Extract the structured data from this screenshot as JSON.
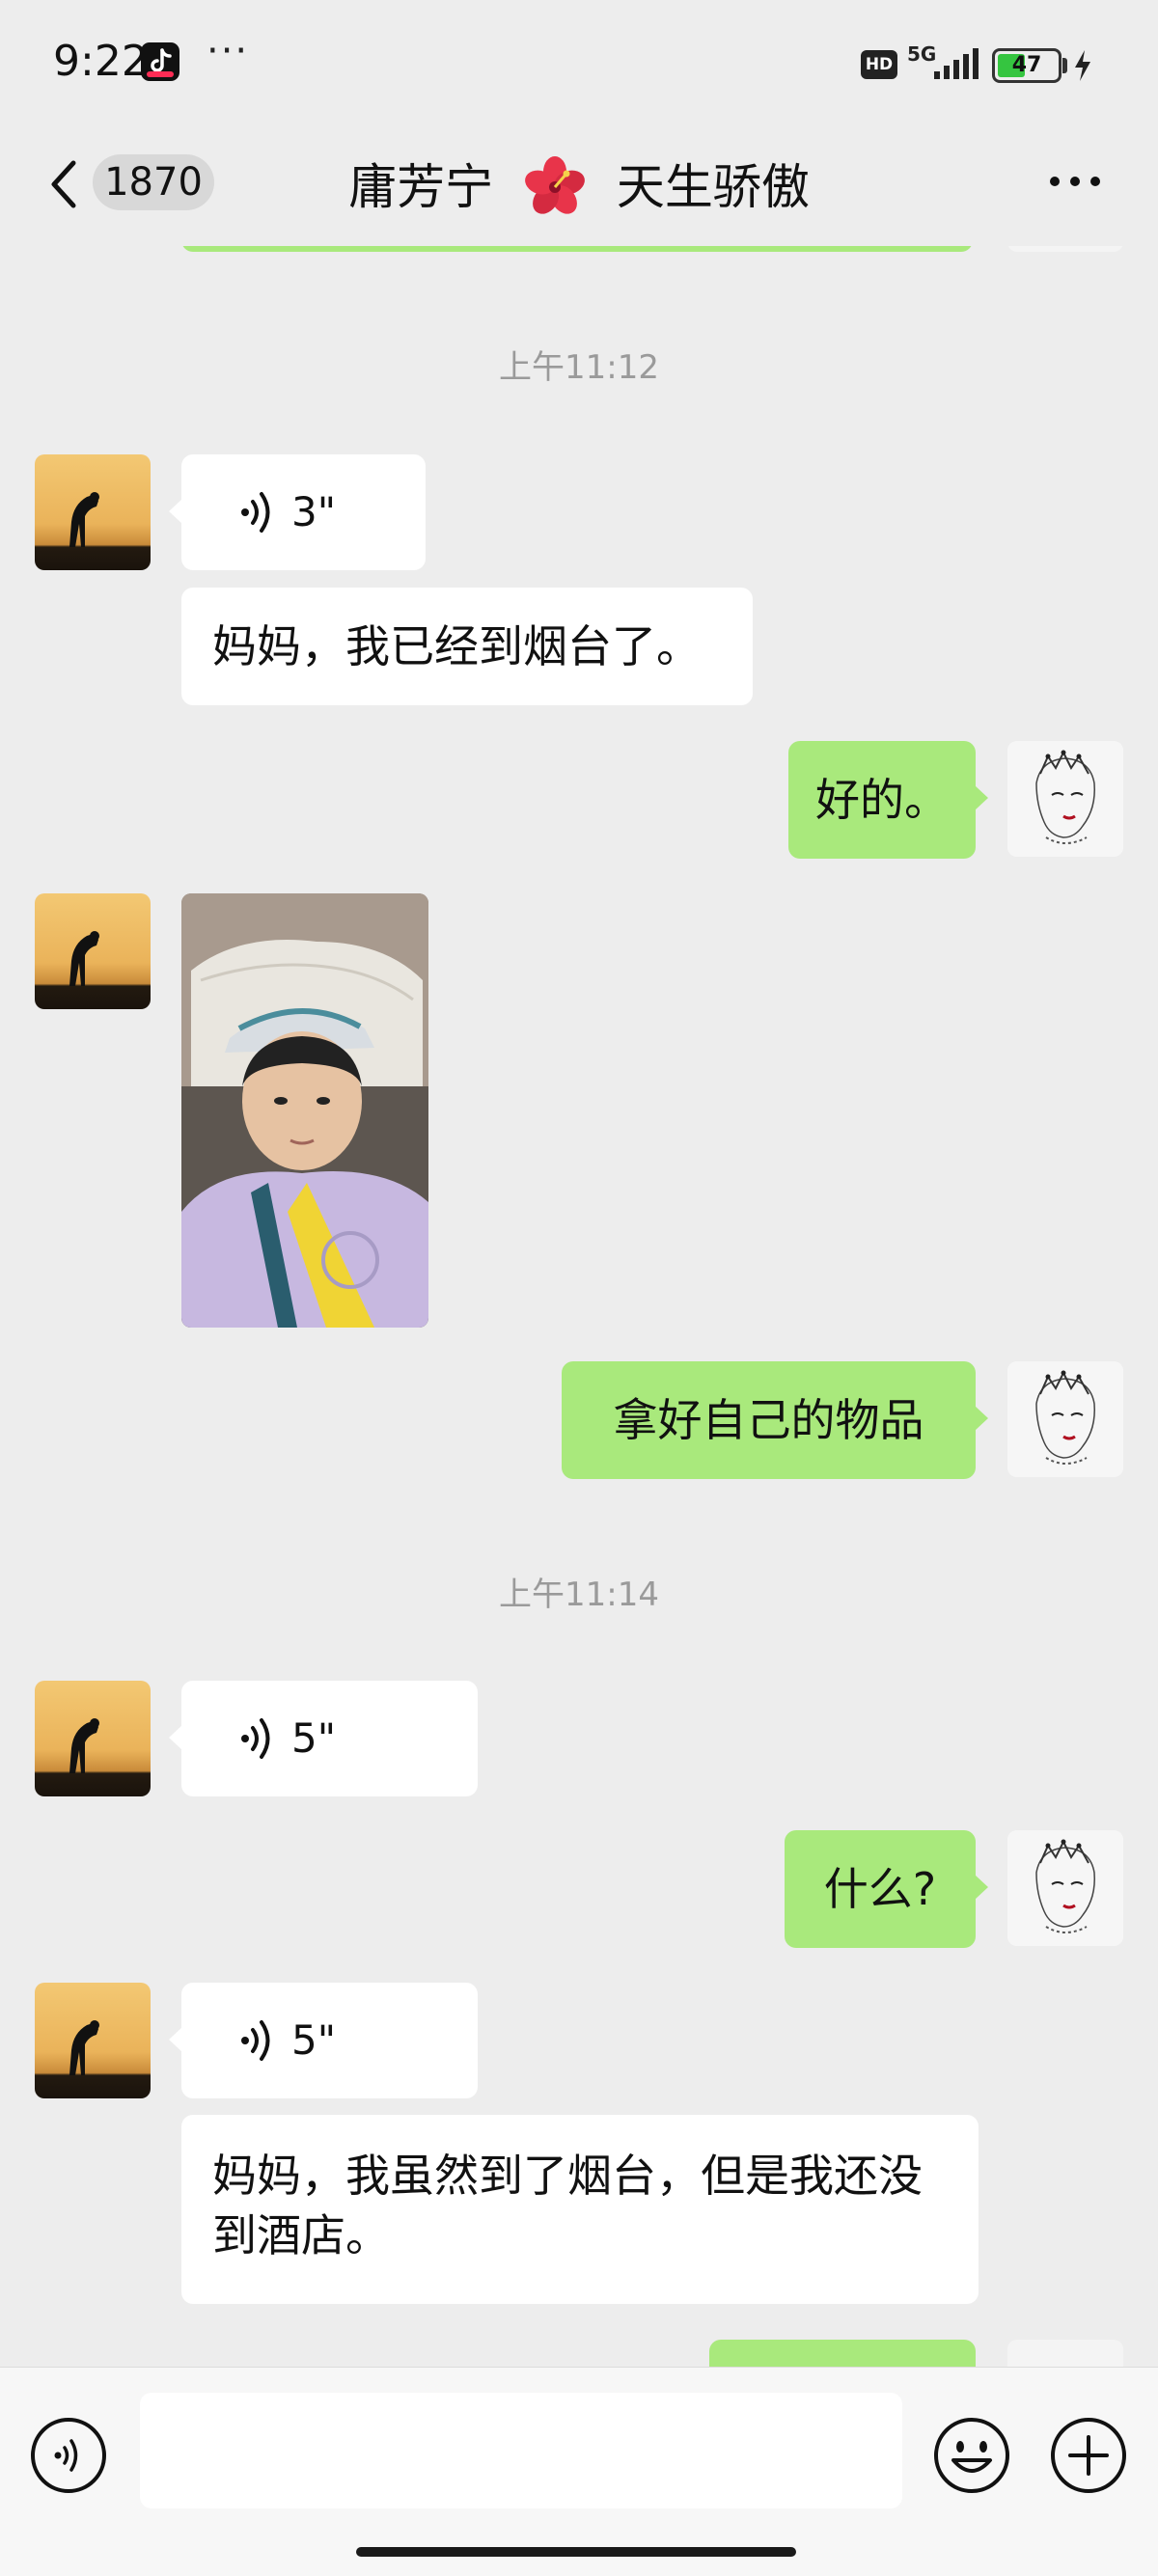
{
  "status_bar": {
    "time": "9:22",
    "more_dots": "···",
    "hd_label": "HD",
    "network_label": "5G",
    "battery_level": "47",
    "battery_fill_color": "#35c540",
    "icons": [
      "tiktok-icon",
      "signal-icon",
      "battery-icon",
      "charging-bolt-icon"
    ]
  },
  "nav": {
    "unread_count": "1870",
    "title_name": "庸芳宁",
    "title_suffix": "天生骄傲",
    "title_emoji_icon": "hibiscus-icon",
    "icons": [
      "back-icon",
      "more-icon"
    ]
  },
  "messages": {
    "time_1": "上午11:12",
    "m1_voice_duration": "3\"",
    "m2_text": "妈妈，我已经到烟台了。",
    "m3_text": "好的。",
    "m4_photo": "photo-child-in-cap",
    "m5_text": "拿好自己的物品",
    "time_2": "上午11:14",
    "m6_voice_duration": "5\"",
    "m7_text": "什么?",
    "m8_voice_duration": "5\"",
    "m9_text": "妈妈，我虽然到了烟台，但是我还没到酒店。"
  },
  "colors": {
    "background": "#ededed",
    "bubble_out": "#a9e97c",
    "bubble_in": "#ffffff",
    "time_text": "#9a9a9a"
  },
  "input_bar": {
    "placeholder": "",
    "icons": [
      "voice-toggle-icon",
      "emoji-icon",
      "plus-icon"
    ]
  }
}
